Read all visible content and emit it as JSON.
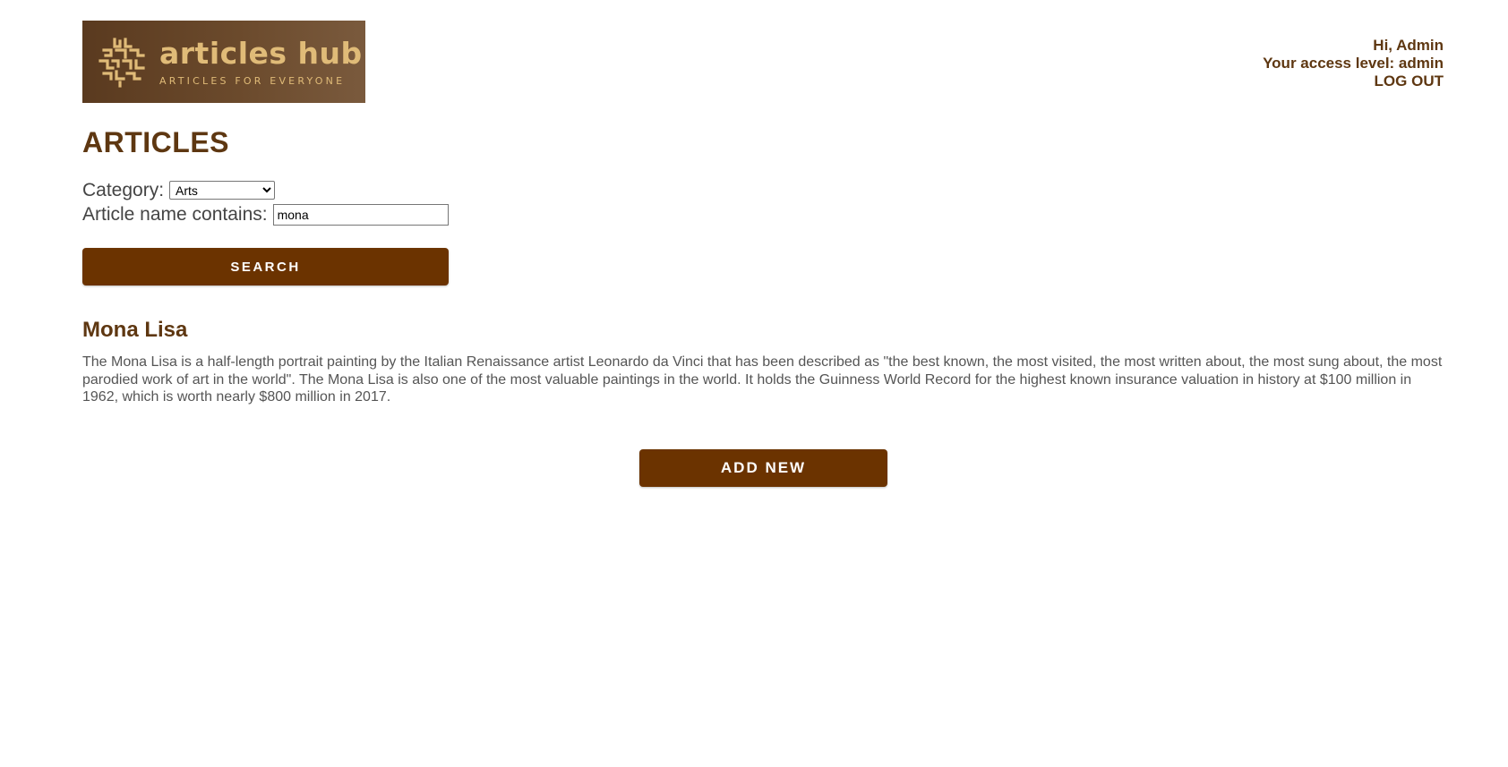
{
  "brand": {
    "name": "articles hub",
    "tagline": "ARTICLES FOR EVERYONE",
    "icon": "maze-logo-icon",
    "accent_color": "#e0bb78",
    "background_color": "#5a3a1f"
  },
  "user": {
    "greeting": "Hi, Admin",
    "access_level": "Your access level: admin",
    "logout_label": "LOG OUT"
  },
  "page": {
    "title": "ARTICLES"
  },
  "filters": {
    "category_label": "Category:",
    "category_selected": "Arts",
    "name_label": "Article name contains:",
    "name_value": "mona",
    "search_label": "SEARCH"
  },
  "articles": [
    {
      "title": "Mona Lisa",
      "body": "The Mona Lisa is a half-length portrait painting by the Italian Renaissance artist Leonardo da Vinci that has been described as \"the best known, the most visited, the most written about, the most sung about, the most parodied work of art in the world\". The Mona Lisa is also one of the most valuable paintings in the world. It holds the Guinness World Record for the highest known insurance valuation in history at $100 million in 1962, which is worth nearly $800 million in 2017."
    }
  ],
  "actions": {
    "add_new_label": "ADD NEW"
  },
  "colors": {
    "primary": "#6b3300",
    "heading": "#5e3711",
    "text": "#555555"
  }
}
